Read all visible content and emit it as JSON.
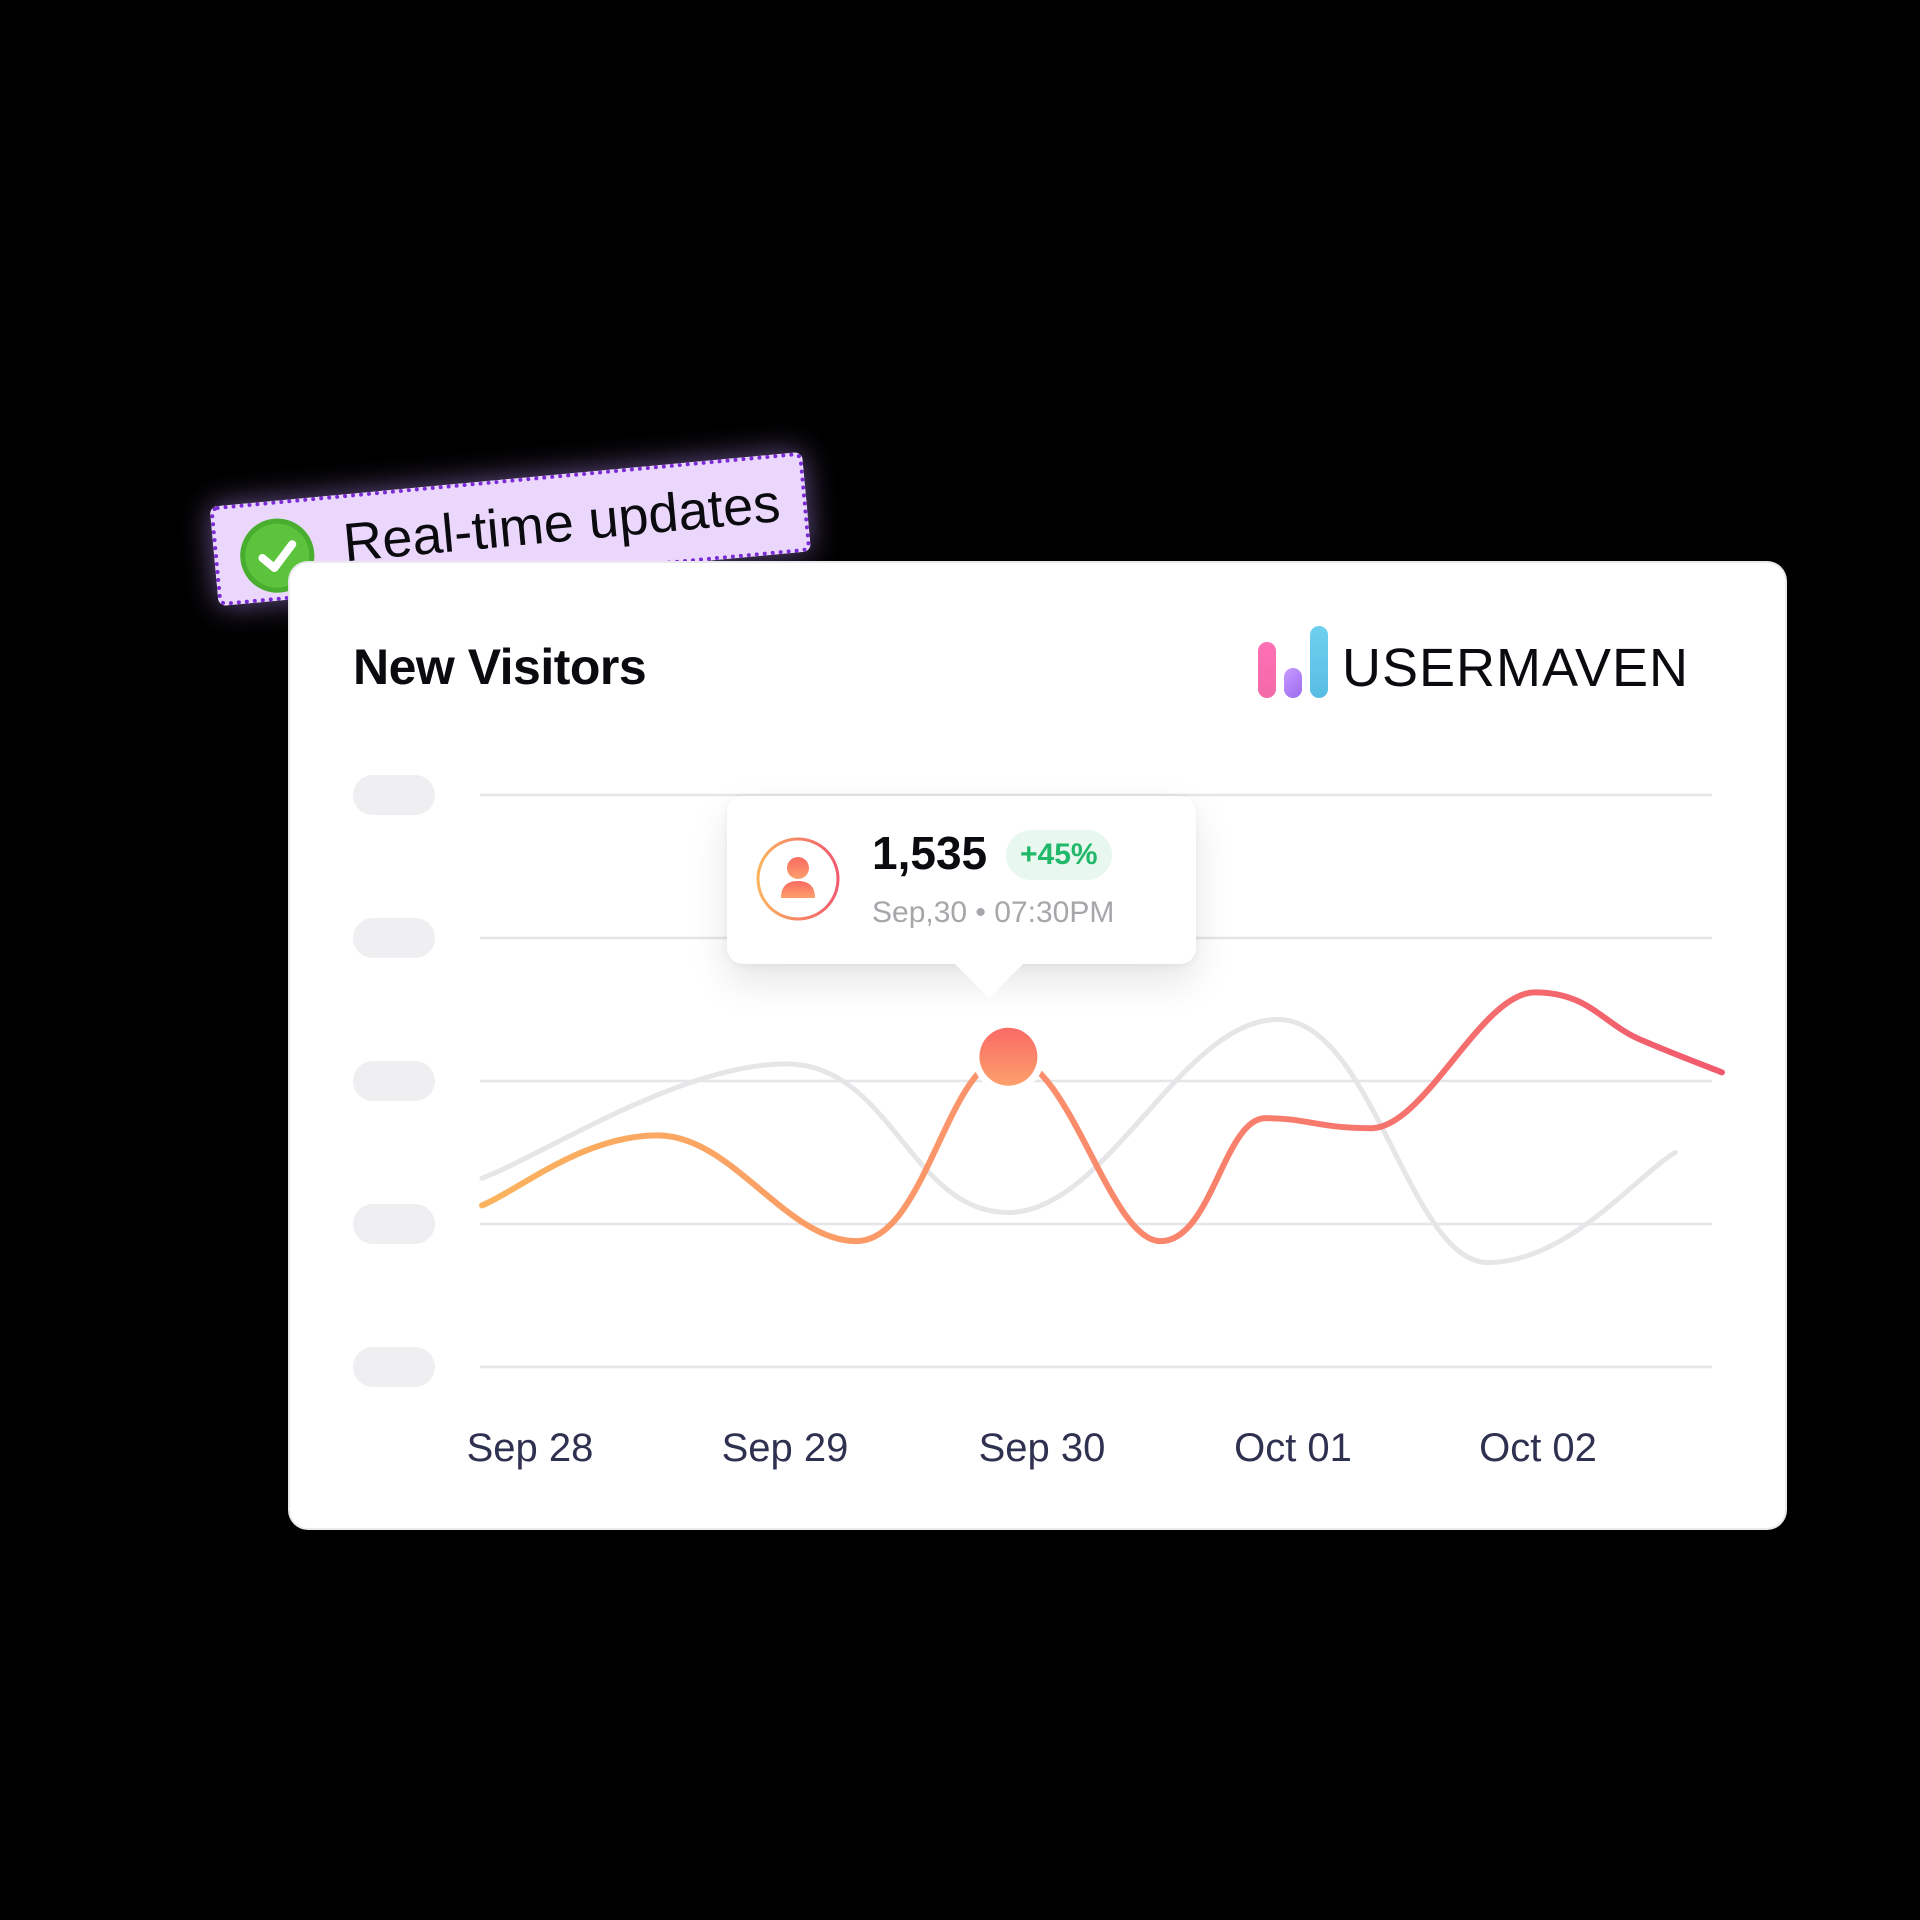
{
  "badge": {
    "label": "Real-time updates",
    "icon": "check-circle-icon",
    "color": "#5cc43c"
  },
  "card": {
    "title": "New Visitors"
  },
  "brand": {
    "name": "USERMAVEN",
    "icon": "bar-chart-logo-icon",
    "colors": [
      "#f26aa8",
      "#a97af5",
      "#62c7ea"
    ]
  },
  "tooltip": {
    "icon": "user-icon",
    "value": "1,535",
    "change": "+45%",
    "timestamp": "Sep,30 • 07:30PM",
    "change_color": "#22b86a"
  },
  "chart_data": {
    "type": "line",
    "title": "New Visitors",
    "xlabel": "",
    "ylabel": "",
    "y_tick_labels": [
      "",
      "",
      "",
      "",
      ""
    ],
    "y_tick_labels_note": "y-axis labels are rendered as blank placeholder pills",
    "ylim": [
      0,
      4
    ],
    "grid": true,
    "categories": [
      "Sep 28",
      "Sep 29",
      "Sep 30",
      "Oct 01",
      "Oct 02"
    ],
    "x_range": [
      27.75,
      33.05
    ],
    "series": [
      {
        "name": "current",
        "style": "gradient orange-to-red",
        "colors": [
          "#fbb35e",
          "#fb8f6c",
          "#f15a6e"
        ],
        "x": [
          27.75,
          28.5,
          29.35,
          30.0,
          30.65,
          31.1,
          31.55,
          32.25,
          32.7,
          33.05
        ],
        "values": [
          1.13,
          1.62,
          0.88,
          2.17,
          0.88,
          1.74,
          1.67,
          2.62,
          2.29,
          2.06
        ],
        "highlight": {
          "x": 30.0,
          "value": 2.17,
          "label": "1,535"
        }
      },
      {
        "name": "previous",
        "style": "light gray",
        "colors": [
          "#e6e6e8"
        ],
        "x": [
          27.75,
          29.05,
          30.0,
          31.15,
          32.05,
          32.85
        ],
        "values": [
          1.32,
          2.12,
          1.08,
          2.43,
          0.73,
          1.5
        ]
      }
    ]
  }
}
